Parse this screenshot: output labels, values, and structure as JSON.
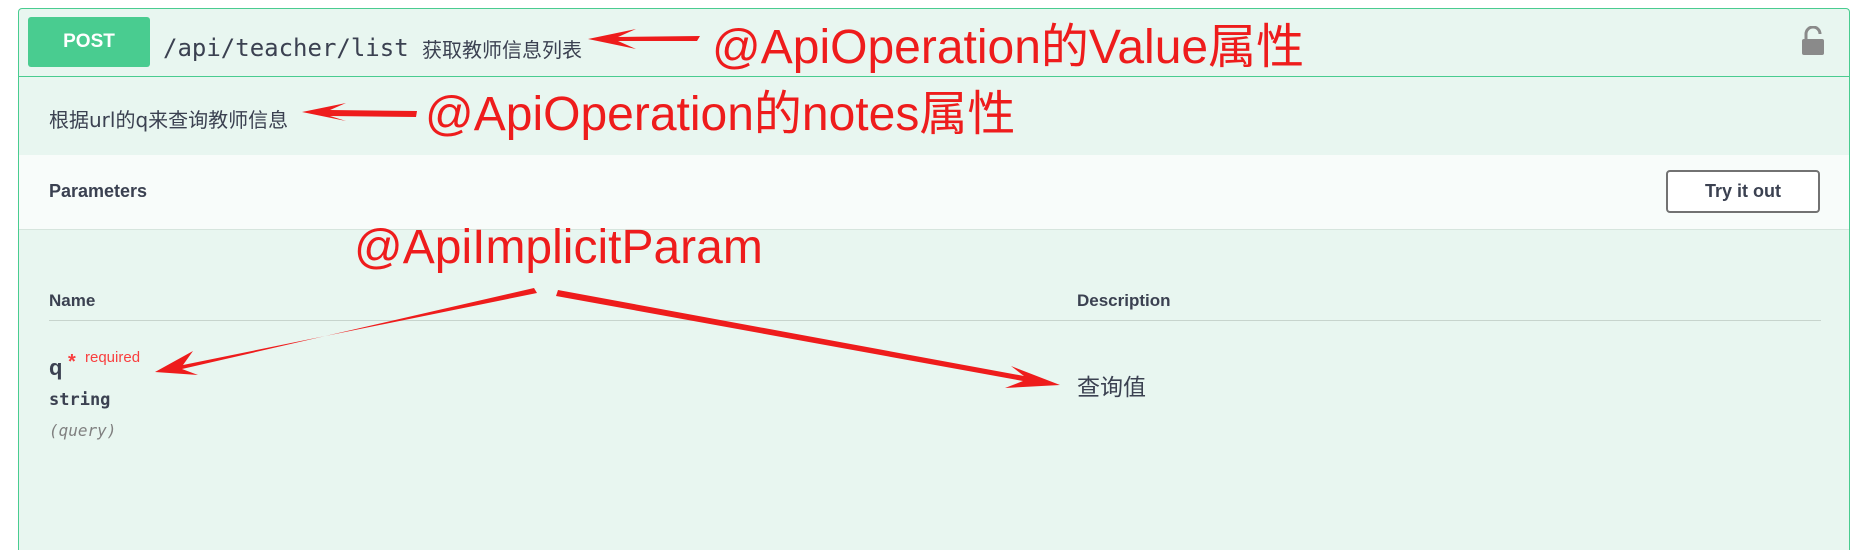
{
  "operation": {
    "method": "POST",
    "path": "/api/teacher/list",
    "summary": "获取教师信息列表",
    "notes": "根据url的q来查询教师信息",
    "lock_icon": "lock-icon"
  },
  "parameters": {
    "title": "Parameters",
    "try_button_label": "Try it out",
    "columns": {
      "name": "Name",
      "description": "Description"
    },
    "items": [
      {
        "name": "q",
        "required_star": "*",
        "required_label": "required",
        "type": "string",
        "in": "(query)",
        "description": "查询值"
      }
    ]
  },
  "annotations": {
    "value": "@ApiOperation的Value属性",
    "notes": "@ApiOperation的notes属性",
    "param": "@ApiImplicitParam"
  },
  "colors": {
    "post_green": "#49cc90",
    "block_background": "#e8f6f0",
    "text": "#3b4151",
    "required_red": "#f93e3e",
    "annotation_red": "#ee1c1c"
  }
}
